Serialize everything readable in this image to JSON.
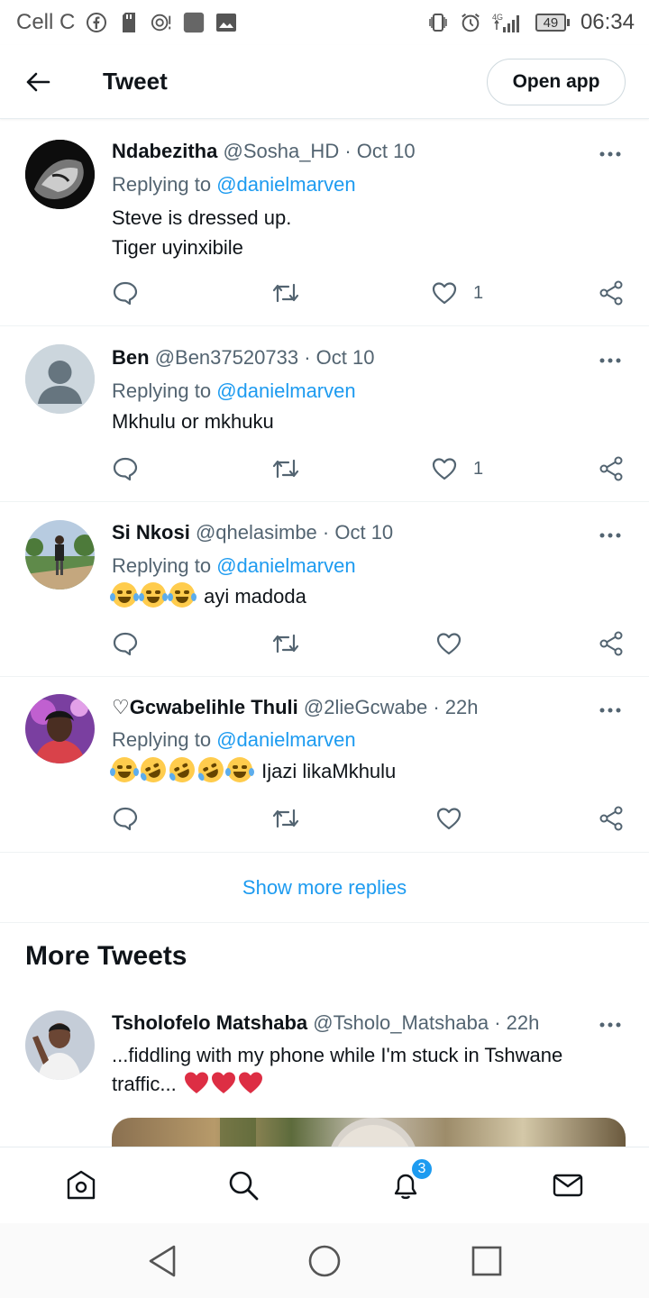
{
  "status_bar": {
    "carrier": "Cell C",
    "battery": "49",
    "network": "4G",
    "time": "06:34"
  },
  "header": {
    "title": "Tweet",
    "open_app_label": "Open app"
  },
  "replies": [
    {
      "name": "Ndabezitha",
      "handle": "@Sosha_HD",
      "time": "· Oct 10",
      "replying_prefix": "Replying to ",
      "replying_to": "@danielmarven",
      "text_line1": "Steve is dressed up.",
      "text_line2": "Tiger uyinxibile",
      "likes": "1"
    },
    {
      "name": "Ben",
      "handle": "@Ben37520733",
      "time": "· Oct 10",
      "replying_prefix": "Replying to ",
      "replying_to": "@danielmarven",
      "text_line1": "Mkhulu or mkhuku",
      "likes": "1"
    },
    {
      "name": "Si Nkosi",
      "handle": "@qhelasimbe",
      "time": "· Oct 10",
      "replying_prefix": "Replying to ",
      "replying_to": "@danielmarven",
      "text_line1": "ayi madoda",
      "likes": ""
    },
    {
      "name": "♡Gcwabelihle Thuli",
      "handle": "@2lieGcwabe",
      "time": "· 22h",
      "replying_prefix": "Replying to ",
      "replying_to": "@danielmarven",
      "text_line1": "Ijazi likaMkhulu",
      "likes": ""
    }
  ],
  "show_more_label": "Show more replies",
  "more_tweets": {
    "title": "More Tweets",
    "tweet": {
      "name": "Tsholofelo Matshaba",
      "handle": "@Tsholo_Matshaba",
      "time": "· 22h",
      "text": "...fiddling with my phone while I'm stuck in Tshwane traffic..."
    }
  },
  "bottom_nav": {
    "notifications_badge": "3"
  },
  "colors": {
    "accent": "#1d9bf0",
    "secondary_text": "#536471",
    "heart_red": "#e0245e"
  }
}
